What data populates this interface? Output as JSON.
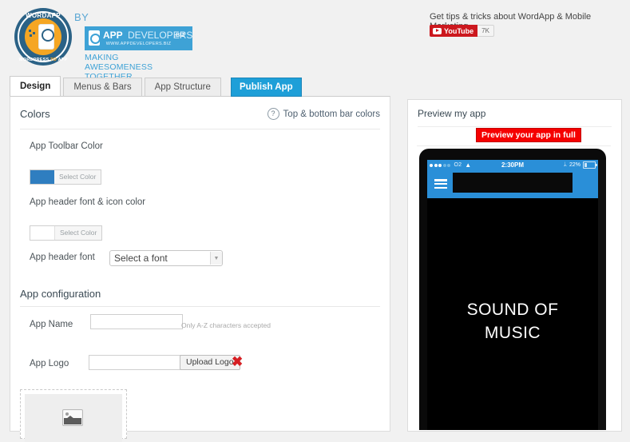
{
  "header": {
    "logo": {
      "badge_top_text": "WORDAPP",
      "badge_bottom_text_1": "WORDPRESS ",
      "badge_bottom_text_2": "TO",
      "badge_bottom_text_3": " APP",
      "by_text": "BY",
      "banner_word_1": "APP",
      "banner_word_2": "DEVELOPERS",
      "banner_word_3": ".BIZ",
      "banner_url": "WWW.APPDEVELOPERS.BIZ",
      "tagline": "MAKING AWESOMENESS TOGETHER"
    },
    "tips_text": "Get tips & tricks about WordApp & Mobile Marketing.",
    "youtube_label": "YouTube",
    "youtube_count": "7K"
  },
  "tabs": [
    {
      "label": "Design",
      "active": true
    },
    {
      "label": "Menus & Bars",
      "active": false
    },
    {
      "label": "App Structure",
      "active": false
    }
  ],
  "publish_button": "Publish App",
  "colors_section": {
    "title": "Colors",
    "helper_text": "Top & bottom bar colors",
    "helper_icon": "question-circle-icon",
    "toolbar_color": {
      "label": "App Toolbar Color",
      "button_label": "Select Color",
      "swatch_hex": "#2f7ec0"
    },
    "header_font_color": {
      "label": "App header font & icon color",
      "button_label": "Select Color",
      "swatch_hex": "#ffffff"
    },
    "header_font": {
      "label": "App header font",
      "selected_option": "Select a font",
      "arrow_icon": "chevron-down-icon"
    }
  },
  "config_section": {
    "title": "App configuration",
    "app_name": {
      "label": "App Name",
      "value": "",
      "hint": "Only A-Z characters accepted"
    },
    "app_logo": {
      "label": "App Logo",
      "value": "",
      "upload_label": "Upload Logo",
      "remove_icon": "red-x-icon",
      "remove_glyph": "✖",
      "placeholder_icon": "broken-image-icon"
    }
  },
  "preview": {
    "title": "Preview my app",
    "full_preview_button": "Preview your app in full",
    "phone": {
      "carrier": "O2",
      "wifi_icon": "wifi-icon",
      "time": "2:30PM",
      "bluetooth_icon": "bluetooth-icon",
      "bluetooth_glyph": "ᛦ",
      "battery_percent": "22%",
      "menu_icon": "hamburger-menu-icon",
      "splash_line_1": "SOUND OF",
      "splash_line_2": "MUSIC"
    }
  }
}
